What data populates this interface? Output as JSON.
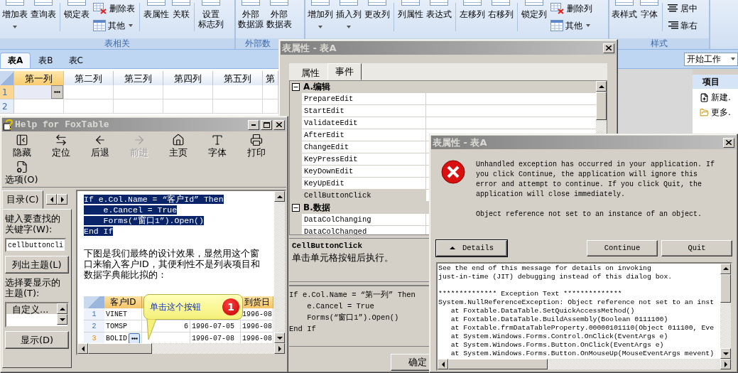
{
  "ribbon": {
    "groups": [
      {
        "label": "表相关",
        "items": [
          {
            "kind": "large",
            "lines": [
              "增加表"
            ],
            "caret": true
          },
          {
            "kind": "large",
            "lines": [
              "查询表"
            ],
            "caret": false
          },
          {
            "kind": "separator"
          },
          {
            "kind": "large",
            "lines": [
              "锁定表"
            ],
            "caret": false
          },
          {
            "kind": "stack",
            "items": [
              {
                "label": "删除表",
                "caret": false
              },
              {
                "label": "其他",
                "caret": true
              }
            ]
          },
          {
            "kind": "separator"
          },
          {
            "kind": "large",
            "lines": [
              "表属性"
            ],
            "caret": false
          },
          {
            "kind": "large",
            "lines": [
              "关联"
            ],
            "caret": false
          },
          {
            "kind": "separator"
          },
          {
            "kind": "large",
            "lines": [
              "设置",
              "标志列"
            ],
            "caret": false
          }
        ]
      },
      {
        "label": "外部数",
        "items": [
          {
            "kind": "large",
            "lines": [
              "外部",
              "数据源"
            ],
            "caret": false
          },
          {
            "kind": "large",
            "lines": [
              "外部",
              "数据表"
            ],
            "caret": false
          }
        ]
      },
      {
        "items": [
          {
            "kind": "large",
            "lines": [
              "增加列"
            ],
            "caret": true
          },
          {
            "kind": "large",
            "lines": [
              "插入列"
            ],
            "caret": true
          },
          {
            "kind": "large",
            "lines": [
              "更改列"
            ],
            "caret": false
          },
          {
            "kind": "separator"
          },
          {
            "kind": "large",
            "lines": [
              "列属性"
            ],
            "caret": false
          },
          {
            "kind": "large",
            "lines": [
              "表达式"
            ],
            "caret": false
          },
          {
            "kind": "separator"
          },
          {
            "kind": "large",
            "lines": [
              "左移列"
            ],
            "caret": false
          },
          {
            "kind": "large",
            "lines": [
              "右移列"
            ],
            "caret": false
          },
          {
            "kind": "separator"
          },
          {
            "kind": "large",
            "lines": [
              "锁定列"
            ],
            "caret": false
          },
          {
            "kind": "stack",
            "items": [
              {
                "label": "删除列",
                "caret": false
              },
              {
                "label": "其他",
                "caret": true
              }
            ]
          }
        ]
      },
      {
        "label": "样式",
        "items": [
          {
            "kind": "large",
            "lines": [
              "表样式"
            ],
            "caret": false
          },
          {
            "kind": "large",
            "lines": [
              "字体"
            ],
            "caret": false
          },
          {
            "kind": "separator"
          },
          {
            "kind": "stack",
            "items": [
              {
                "label": "居中",
                "caret": false
              },
              {
                "label": "靠右",
                "caret": false
              }
            ]
          }
        ]
      }
    ]
  },
  "sheet_tabs": [
    {
      "label": "表A",
      "selected": true
    },
    {
      "label": "表B",
      "selected": false
    },
    {
      "label": "表C",
      "selected": false
    }
  ],
  "start_dropdown": {
    "value": "开始工作"
  },
  "grid": {
    "columns": [
      {
        "label": "第一列",
        "selected": true
      },
      {
        "label": "第二列",
        "selected": false
      },
      {
        "label": "第三列",
        "selected": false
      },
      {
        "label": "第四列",
        "selected": false
      },
      {
        "label": "第五列",
        "selected": false
      },
      {
        "label": "第",
        "selected": false
      }
    ],
    "rows": [
      {
        "label": "1",
        "selected": true
      },
      {
        "label": "2",
        "selected": false
      }
    ]
  },
  "right_pane": {
    "title": "项目",
    "items": [
      "新建.",
      "更多."
    ]
  },
  "help_window": {
    "title": "Help for FoxTable",
    "toolbar": [
      {
        "label": "隐藏",
        "disabled": false
      },
      {
        "label": "定位",
        "disabled": false
      },
      {
        "label": "后退",
        "disabled": false
      },
      {
        "label": "前进",
        "disabled": true
      },
      {
        "label": "主页",
        "disabled": false
      },
      {
        "label": "字体",
        "disabled": false
      },
      {
        "label": "打印",
        "disabled": false
      },
      {
        "label": "选项(O)",
        "disabled": false
      }
    ],
    "nav_tab": "目录(C)",
    "keyword_label": "键入要查找的关键字(W):",
    "keyword_value": "cellbuttoncli",
    "list_button": "列出主题(L)",
    "topic_label": "选择要显示的主题(T):",
    "topics": [
      {
        "label": "自定义...",
        "selected": true
      }
    ],
    "display_button": "显示(D)",
    "code": [
      "If e.Col.Name = “客户Id” Then",
      "    e.Cancel = True",
      "    Forms(“窗口1”).Open()",
      "End If"
    ],
    "paragraph": "下图是我们最终的设计效果，显然用这个窗口来输入客户ID，其便利性不是列表项目和数据字典能比拟的：",
    "figure": {
      "header": {
        "customer_id": "客户ID",
        "arrival_date": "到货日"
      },
      "rows": [
        {
          "number": "1",
          "selected": false,
          "button": false,
          "customer_id": "VINET",
          "arrival_date": "1996-08"
        },
        {
          "number": "2",
          "selected": false,
          "button": false,
          "customer_id": "TOMSP",
          "column_3": "6",
          "column_4": "1996-07-05",
          "arrival_date": "1996-08"
        },
        {
          "number": "3",
          "selected": true,
          "button": true,
          "customer_id": "BOLID",
          "column_4": "1996-07-08",
          "arrival_date": "1996-08"
        }
      ],
      "callout": {
        "text": "单击这个按钮",
        "badge": "1"
      }
    }
  },
  "property_window": {
    "title": "表属性 - 表A",
    "tabs": [
      {
        "label": "属性",
        "selected": false
      },
      {
        "label": "事件",
        "selected": true
      }
    ],
    "categories": [
      {
        "label": "A.编辑",
        "expanded": true,
        "children": [
          {
            "name": "PrepareEdit",
            "selected": false
          },
          {
            "name": "StartEdit",
            "selected": false
          },
          {
            "name": "ValidateEdit",
            "selected": false
          },
          {
            "name": "AfterEdit",
            "selected": false
          },
          {
            "name": "ChangeEdit",
            "selected": false
          },
          {
            "name": "KeyPressEdit",
            "selected": false
          },
          {
            "name": "KeyDownEdit",
            "selected": false
          },
          {
            "name": "KeyUpEdit",
            "selected": false
          },
          {
            "name": "CellButtonClick",
            "selected": true
          }
        ]
      },
      {
        "label": "B.数据",
        "expanded": true,
        "children": [
          {
            "name": "DataColChanging",
            "selected": false
          },
          {
            "name": "DataColChanged",
            "selected": false
          }
        ]
      }
    ],
    "description": {
      "title": "CellButtonClick",
      "text": "单击单元格按钮后执行。"
    },
    "code": [
      "If e.Col.Name = “第一列” Then",
      "    e.Cancel = True",
      "    Forms(“窗口1”).Open()",
      "End If"
    ],
    "ok_button": "确定"
  },
  "error_dialog": {
    "title": "表属性 - 表A",
    "message": "Unhandled exception has occurred in your application. If you click Continue, the application will ignore this error and attempt to continue. If you click Quit, the application will close immediately.",
    "detail_message": "Object reference not set to an instance of an object.",
    "buttons": [
      {
        "label": "Details",
        "kind": "toggle"
      },
      {
        "label": "Continue",
        "kind": "plain"
      },
      {
        "label": "Quit",
        "kind": "plain"
      }
    ],
    "details": [
      {
        "lines": [
          "See the end of this message for details on invoking",
          "just-in-time (JIT) debugging instead of this dialog box."
        ]
      },
      {
        "lines": [
          "************** Exception Text **************",
          "System.NullReferenceException: Object reference not set to an inst",
          "   at Foxtable.DataTable.SetQuickAccessMethod()",
          "   at Foxtable.DataTable.BuildAssembly(Boolean 0111100)",
          "   at Foxtable.frmDataTableProperty.00000101110(Object 011100, Eve",
          "   at System.Windows.Forms.Control.OnClick(EventArgs e)",
          "   at System.Windows.Forms.Button.OnClick(EventArgs e)",
          "   at System.Windows.Forms.Button.OnMouseUp(MouseEventArgs mevent)"
        ]
      }
    ]
  }
}
